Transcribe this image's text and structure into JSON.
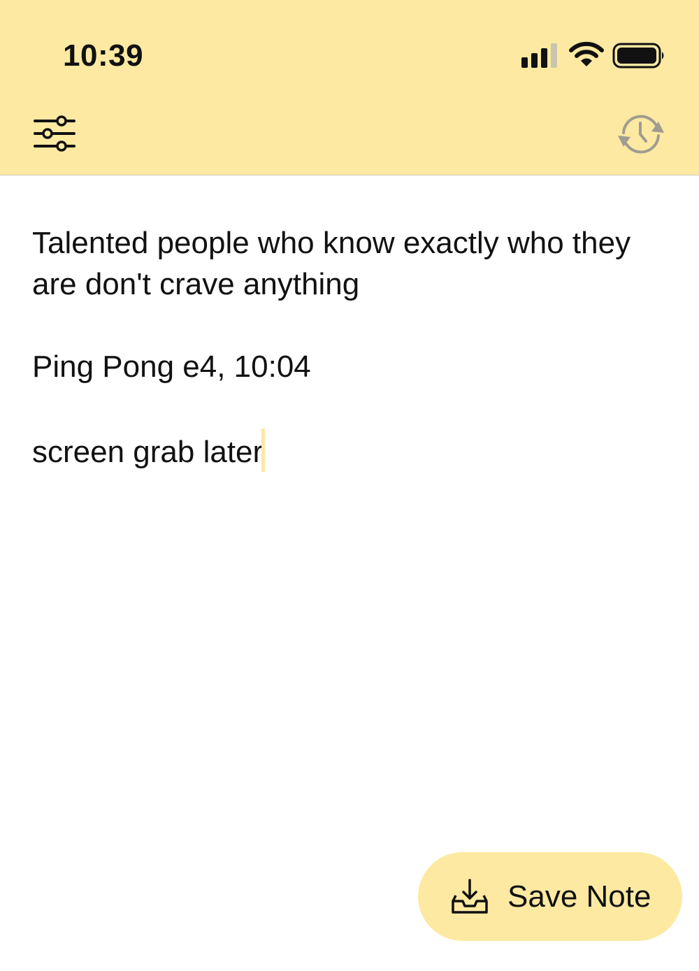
{
  "status_bar": {
    "time": "10:39",
    "icons": [
      "signal-icon",
      "wifi-icon",
      "battery-icon"
    ]
  },
  "toolbar": {
    "left_icon": "sliders-icon",
    "right_icon": "history-icon"
  },
  "note": {
    "lines": [
      "Talented people who know exactly who they",
      "are don't crave anything",
      "",
      "Ping Pong e4, 10:04",
      "",
      "screen grab later"
    ]
  },
  "save_button": {
    "label": "Save Note",
    "icon": "inbox-download-icon"
  },
  "colors": {
    "header_background": "#fde9a2",
    "accent": "#fde9a2",
    "text": "#111111",
    "inactive_icon": "#9a9a92"
  }
}
